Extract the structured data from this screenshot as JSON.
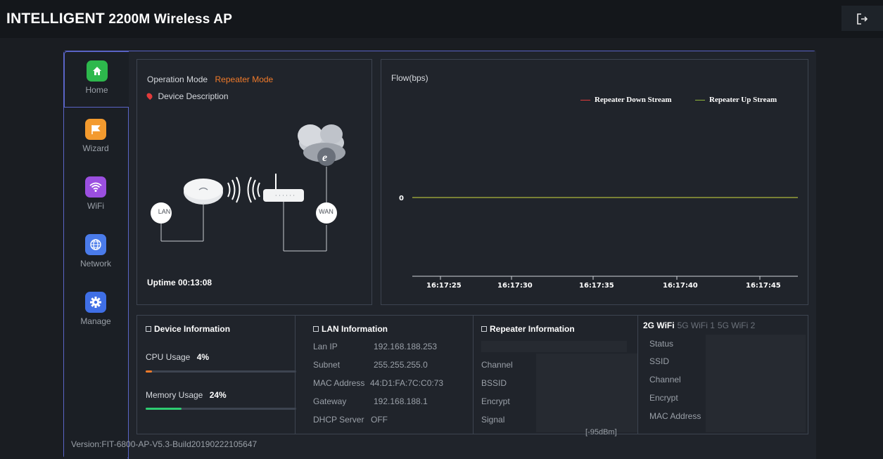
{
  "header": {
    "brand_main": "INTELLIGENT",
    "brand_sub": "2200M Wireless AP",
    "logout_icon": "logout-icon"
  },
  "sidebar": {
    "items": [
      {
        "label": "Home",
        "icon": "home-icon",
        "color": "#2db84c"
      },
      {
        "label": "Wizard",
        "icon": "flag-icon",
        "color": "#f39a2e"
      },
      {
        "label": "WiFi",
        "icon": "wifi-icon",
        "color": "#9b4fe0"
      },
      {
        "label": "Network",
        "icon": "globe-icon",
        "color": "#4a7bea"
      },
      {
        "label": "Manage",
        "icon": "gear-icon",
        "color": "#3f6fe6"
      }
    ]
  },
  "status": {
    "operation_mode_label": "Operation Mode",
    "operation_mode_value": "Repeater Mode",
    "device_description": "Device Description",
    "lan_tag": "LAN",
    "wan_tag": "WAN",
    "uptime_label": "Uptime",
    "uptime_value": "00:13:08"
  },
  "flow": {
    "title": "Flow(bps)"
  },
  "chart_data": {
    "type": "line",
    "title": "Flow(bps)",
    "x": [
      "16:17:25",
      "16:17:30",
      "16:17:35",
      "16:17:40",
      "16:17:45"
    ],
    "series": [
      {
        "name": "Repeater Down Stream",
        "values": [
          0,
          0,
          0,
          0,
          0
        ],
        "color": "#e23b3b"
      },
      {
        "name": "Repeater Up Stream",
        "values": [
          0,
          0,
          0,
          0,
          0
        ],
        "color": "#8fb53a"
      }
    ],
    "yticks": [
      "0"
    ],
    "legend": "top-right"
  },
  "device_info": {
    "title": "Device Information",
    "cpu_label": "CPU Usage",
    "cpu_value": "4%",
    "cpu_pct": 4,
    "mem_label": "Memory Usage",
    "mem_value": "24%",
    "mem_pct": 24,
    "cpu_color": "#f07a2a",
    "mem_color": "#2ecc71"
  },
  "lan_info": {
    "title": "LAN Information",
    "rows": [
      {
        "k": "Lan IP",
        "v": "192.168.188.253"
      },
      {
        "k": "Subnet",
        "v": "255.255.255.0"
      },
      {
        "k": "MAC Address",
        "v": "44:D1:FA:7C:C0:73"
      },
      {
        "k": "Gateway",
        "v": "192.168.188.1"
      },
      {
        "k": "DHCP Server",
        "v": "OFF"
      }
    ]
  },
  "repeater_info": {
    "title": "Repeater Information",
    "rows": [
      "Channel",
      "BSSID",
      "Encrypt",
      "Signal"
    ],
    "signal_value": "[-95dBm]"
  },
  "wifi_info": {
    "tabs": [
      "2G WiFi",
      "5G WiFi 1",
      "5G WiFi 2"
    ],
    "rows": [
      "Status",
      "SSID",
      "Channel",
      "Encrypt",
      "MAC Address"
    ]
  },
  "footer": {
    "version": "Version:FIT-6800-AP-V5.3-Build20190222105647"
  }
}
